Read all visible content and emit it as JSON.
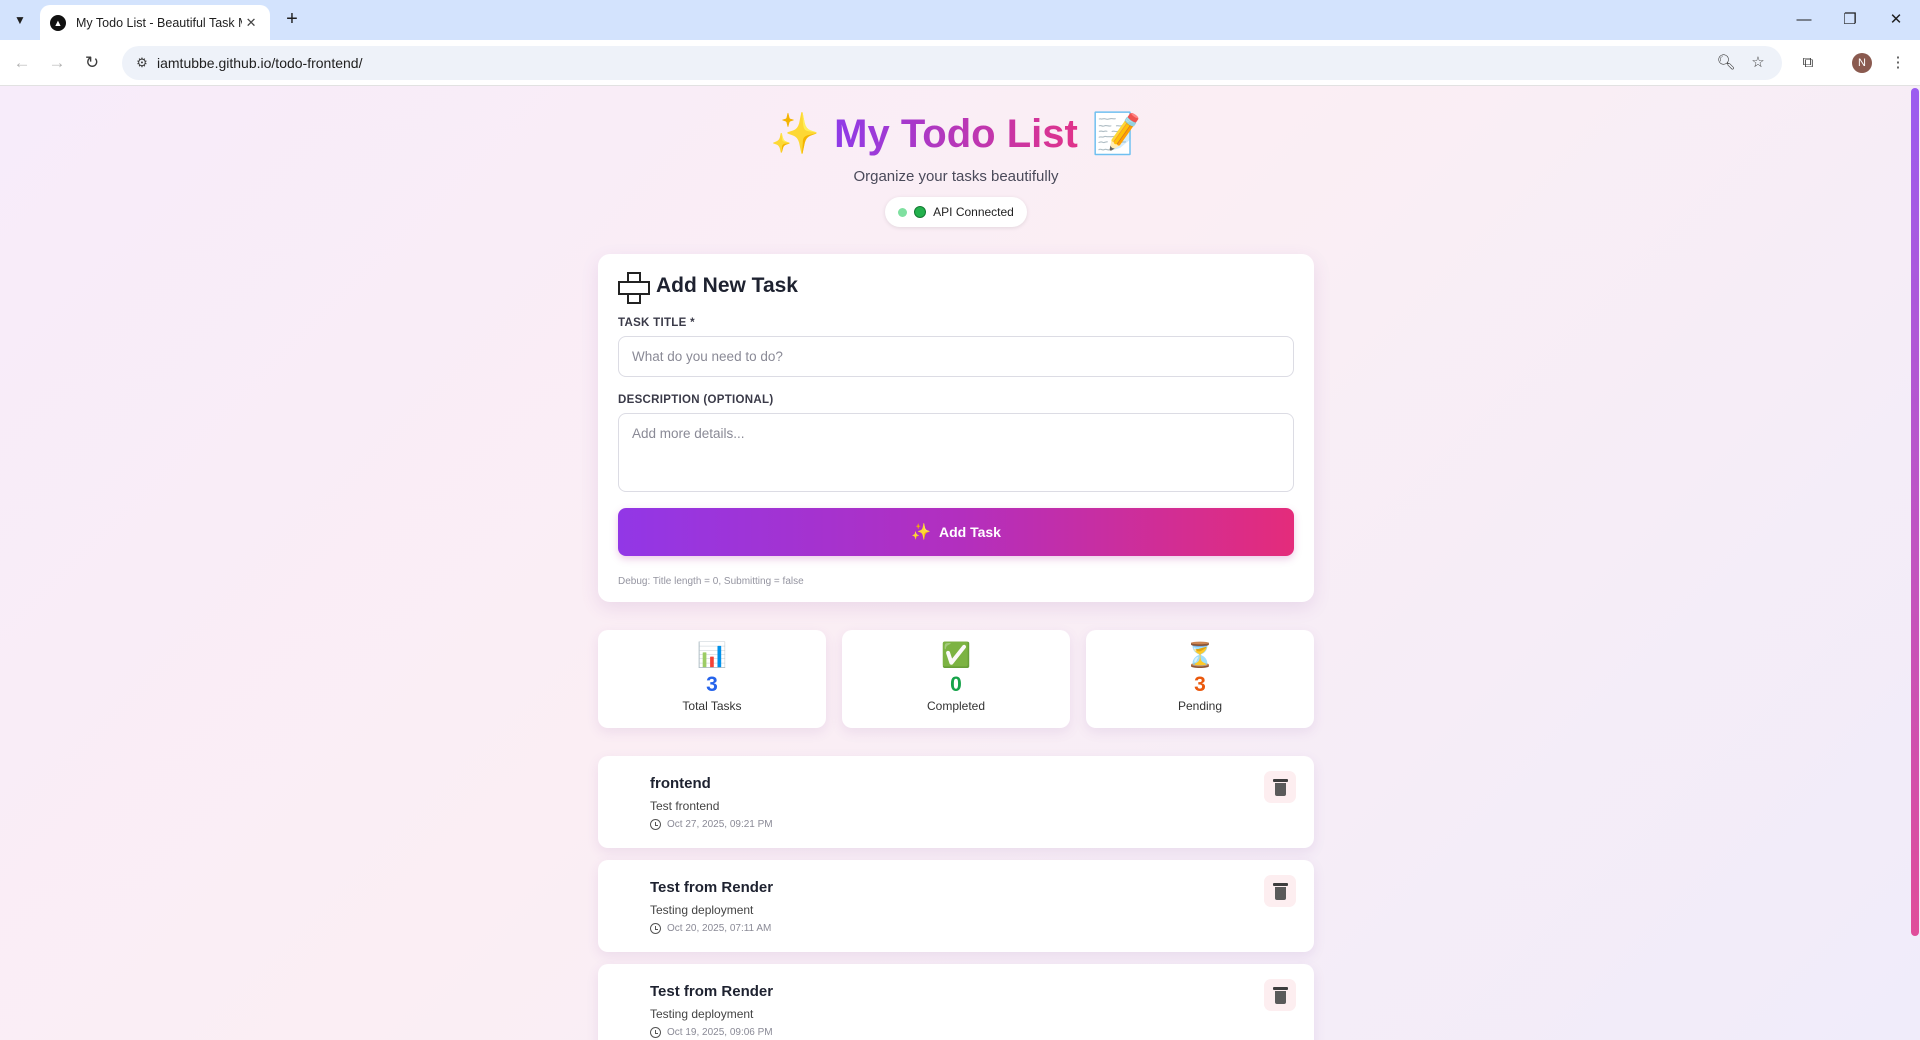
{
  "browser": {
    "tab_title": "My Todo List - Beautiful Task Manager",
    "url": "iamtubbe.github.io/todo-frontend/",
    "profile_initial": "N"
  },
  "header": {
    "emoji_left": "✨",
    "title": "My Todo List",
    "emoji_right": "📝",
    "subtitle": "Organize your tasks beautifully",
    "status": "API Connected"
  },
  "form": {
    "heading": "Add New Task",
    "title_label": "TASK TITLE *",
    "title_value": "",
    "title_placeholder": "What do you need to do?",
    "description_label": "DESCRIPTION (OPTIONAL)",
    "description_value": "",
    "description_placeholder": "Add more details...",
    "submit_emoji": "✨",
    "submit_label": "Add Task",
    "debug": "Debug: Title length = 0, Submitting = false"
  },
  "stats": [
    {
      "icon": "📊",
      "value": "3",
      "label": "Total Tasks",
      "color": "#2563eb"
    },
    {
      "icon": "✅",
      "value": "0",
      "label": "Completed",
      "color": "#16a34a"
    },
    {
      "icon": "⏳",
      "value": "3",
      "label": "Pending",
      "color": "#ea580c"
    }
  ],
  "todos": [
    {
      "title": "frontend",
      "description": "Test frontend",
      "date": "Oct 27, 2025, 09:21 PM"
    },
    {
      "title": "Test from Render",
      "description": "Testing deployment",
      "date": "Oct 20, 2025, 07:11 AM"
    },
    {
      "title": "Test from Render",
      "description": "Testing deployment",
      "date": "Oct 19, 2025, 09:06 PM"
    }
  ],
  "colors": {
    "accent_start": "#9237e6",
    "accent_end": "#e42c7b",
    "status_green": "#23b14d"
  }
}
